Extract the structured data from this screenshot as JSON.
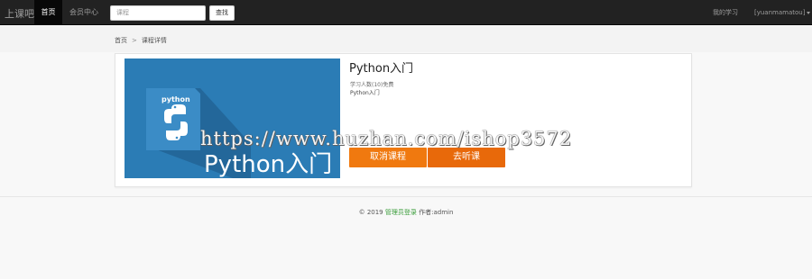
{
  "navbar": {
    "brand": "上课吧",
    "home": "首页",
    "member": "会员中心",
    "search_placeholder": "课程",
    "search_button": "查找",
    "my_study": "我的学习",
    "user": "[yuanmamatou]"
  },
  "breadcrumb": {
    "home": "首页",
    "separator": ">",
    "current": "课程详情"
  },
  "course": {
    "title": "Python入门",
    "cover_logo_text": "python",
    "cover_title": "Python入门",
    "meta": "学习人数(10)免费",
    "description": "Python入门",
    "cancel_button": "取消课程",
    "listen_button": "去听课",
    "colors": {
      "cover_bg": "#2b7cb5",
      "cancel_button": "#f0790f",
      "listen_button": "#e8690a"
    }
  },
  "watermark": "https://www.huzhan.com/ishop3572",
  "footer": {
    "copyright": "© 2019",
    "admin_login": "管理员登录",
    "author": "作者:admin"
  }
}
